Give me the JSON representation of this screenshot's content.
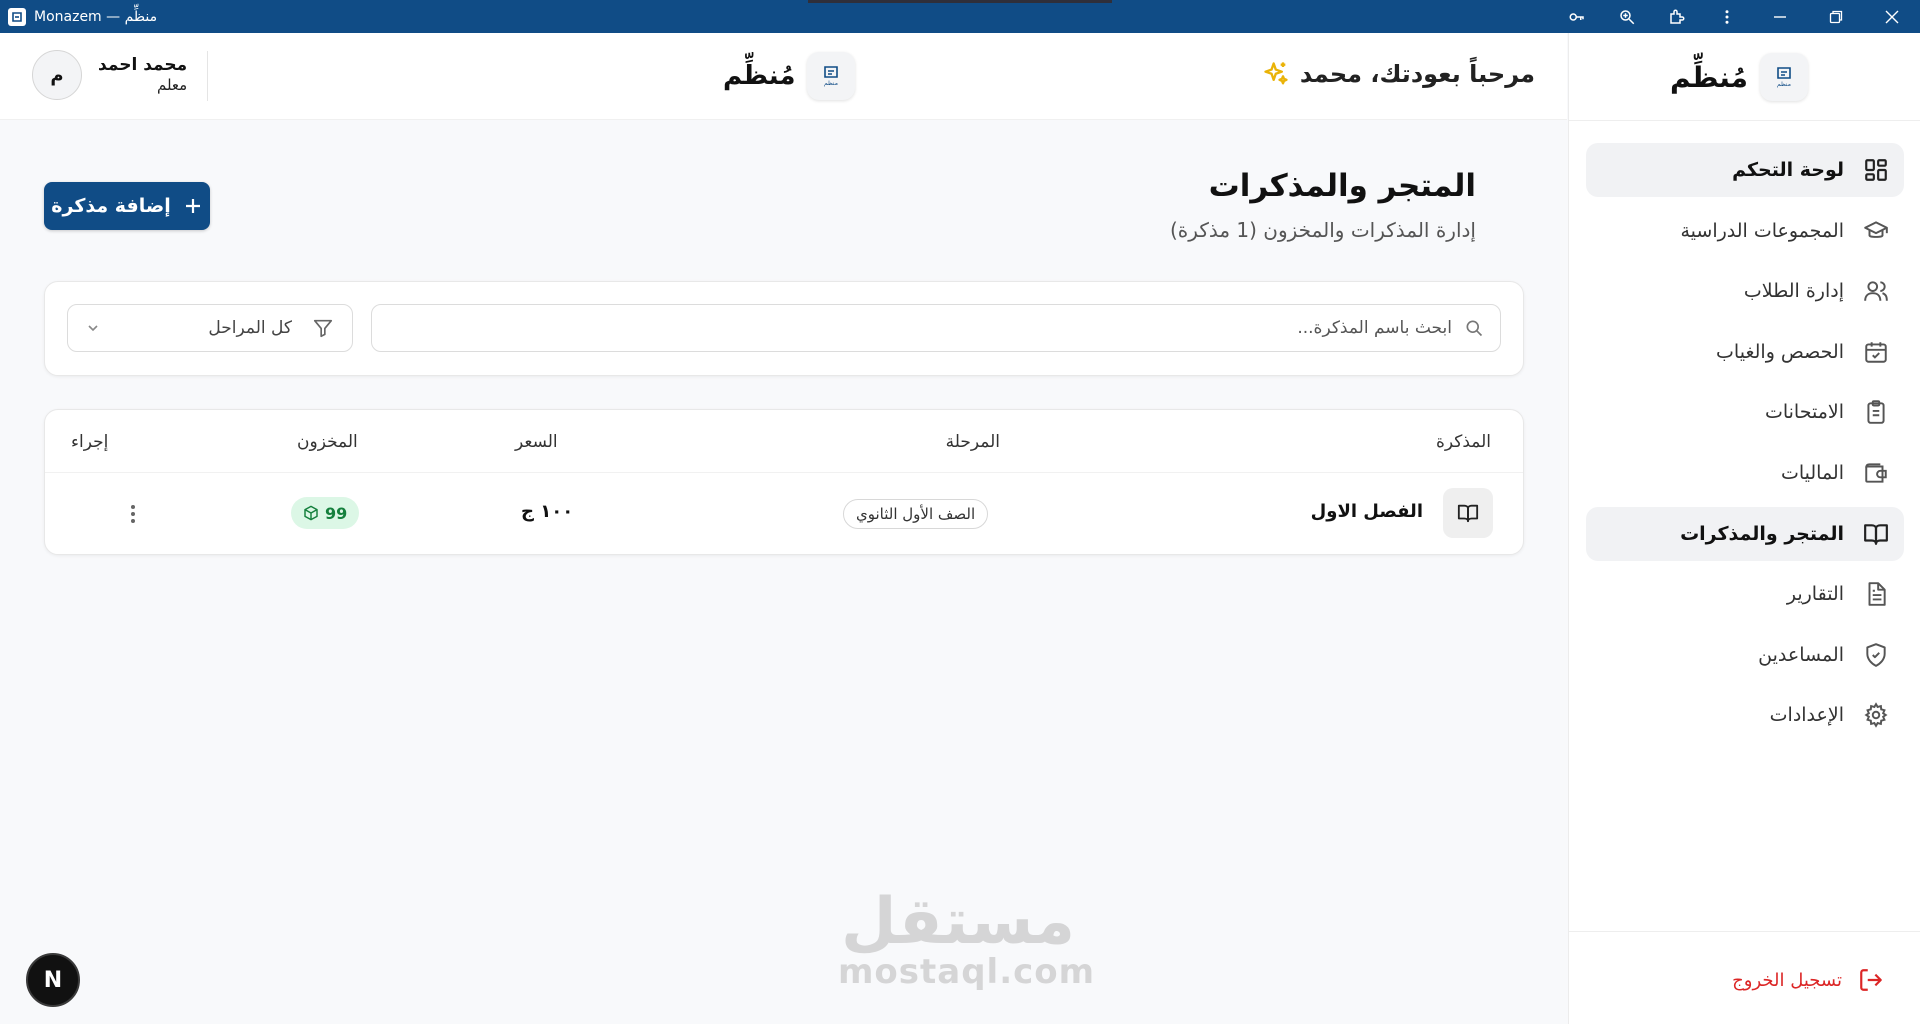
{
  "window": {
    "title": "Monazem — منظِّم",
    "app_icon": "logo-icon",
    "controls": [
      "key-icon",
      "zoom-icon",
      "extensions-icon",
      "more-vertical-icon",
      "minimize-icon",
      "restore-icon",
      "close-icon"
    ]
  },
  "brand": {
    "name": "مُنظِّم",
    "logo_text": "منظم",
    "accent": "#104c86"
  },
  "sidebar": {
    "items": [
      {
        "label": "لوحة التحكم",
        "icon": "grid-icon",
        "active": true
      },
      {
        "label": "المجموعات الدراسية",
        "icon": "graduation-cap-icon",
        "active": false
      },
      {
        "label": "إدارة الطلاب",
        "icon": "users-icon",
        "active": false
      },
      {
        "label": "الحصص والغياب",
        "icon": "calendar-check-icon",
        "active": false
      },
      {
        "label": "الامتحانات",
        "icon": "clipboard-icon",
        "active": false
      },
      {
        "label": "الماليات",
        "icon": "wallet-icon",
        "active": false
      },
      {
        "label": "المتجر والمذكرات",
        "icon": "book-open-icon",
        "active": true
      },
      {
        "label": "التقارير",
        "icon": "file-text-icon",
        "active": false
      },
      {
        "label": "المساعدين",
        "icon": "shield-check-icon",
        "active": false
      },
      {
        "label": "الإعدادات",
        "icon": "gear-icon",
        "active": false
      }
    ],
    "logout": "تسجيل الخروج",
    "logout_color": "#dc2626"
  },
  "header": {
    "greeting": "مرحباً بعودتك، محمد",
    "greeting_icon": "sparkles-icon",
    "brand_name": "مُنظِّم",
    "user": {
      "name": "محمد احمد",
      "role": "معلم",
      "avatar_letter": "م"
    }
  },
  "page": {
    "title": "المتجر والمذكرات",
    "subtitle": "إدارة المذكرات والمخزون (1 مذكرة)",
    "add_button": "إضافة مذكرة"
  },
  "filters": {
    "search_placeholder": "ابحث باسم المذكرة...",
    "search_value": "",
    "stage_selected": "كل المراحل"
  },
  "table": {
    "headers": {
      "name": "المذكرة",
      "stage": "المرحلة",
      "price": "السعر",
      "stock": "المخزون",
      "action": "إجراء"
    },
    "rows": [
      {
        "name": "الفصل الاول",
        "stage": "الصف الأول الثانوي",
        "price": "١٠٠ ج",
        "stock": "99",
        "stock_color": "#15803d"
      }
    ]
  },
  "watermark": {
    "ar": "مستقل",
    "en": "mostaql.com"
  },
  "dev_badge": "N"
}
